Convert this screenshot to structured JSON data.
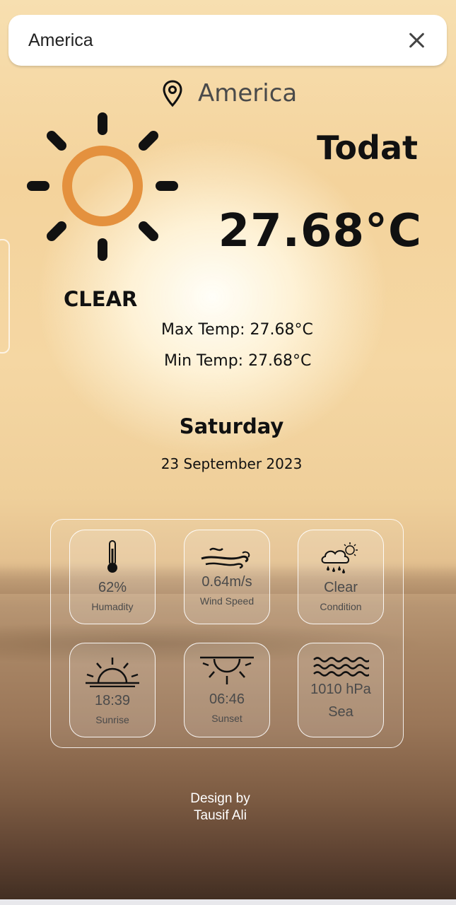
{
  "search": {
    "value": "America",
    "placeholder": ""
  },
  "location": {
    "name": "America"
  },
  "weather": {
    "today_label": "Todat",
    "temperature": "27.68°C",
    "condition": "CLEAR",
    "max_temp": "Max Temp: 27.68°C",
    "min_temp": "Min Temp: 27.68°C",
    "day": "Saturday",
    "date": "23 September 2023"
  },
  "stats": [
    {
      "icon": "thermometer-icon",
      "value": "62%",
      "label": "Humadity"
    },
    {
      "icon": "wind-icon",
      "value": "0.64m/s",
      "label": "Wind Speed"
    },
    {
      "icon": "cloud-sun-rain-icon",
      "value": "Clear",
      "label": "Condition"
    },
    {
      "icon": "sunrise-icon",
      "value": "18:39",
      "label": "Sunrise"
    },
    {
      "icon": "sunset-icon",
      "value": "06:46",
      "label": "Sunset"
    },
    {
      "icon": "waves-icon",
      "value": "1010 hPa",
      "label": "Sea"
    }
  ],
  "footer": {
    "line1": "Design by",
    "line2": "Tausif Ali"
  },
  "colors": {
    "sun": "#e4913e",
    "text": "#111111",
    "muted": "#4a4a4a"
  }
}
